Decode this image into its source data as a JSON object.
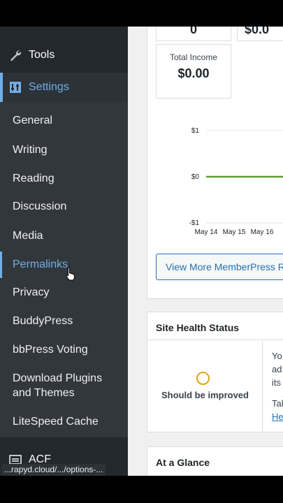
{
  "sidebar": {
    "tools_label": "Tools",
    "settings_label": "Settings",
    "submenu": [
      {
        "label": "General"
      },
      {
        "label": "Writing"
      },
      {
        "label": "Reading"
      },
      {
        "label": "Discussion"
      },
      {
        "label": "Media"
      },
      {
        "label": "Permalinks",
        "active": true
      },
      {
        "label": "Privacy"
      },
      {
        "label": "BuddyPress"
      },
      {
        "label": "bbPress Voting"
      },
      {
        "label": "Download Plugins and Themes"
      },
      {
        "label": "LiteSpeed Cache"
      }
    ],
    "acf_label": "ACF"
  },
  "status_url": "...rapyd.cloud/.../options-...",
  "stats": {
    "top_left_value": "0",
    "top_right_value": "$0.0",
    "total_income_label": "Total Income",
    "total_income_value": "$0.00"
  },
  "chart_data": {
    "type": "line",
    "categories": [
      "May 14",
      "May 15",
      "May 16"
    ],
    "series": [
      {
        "values": [
          0,
          0,
          0
        ]
      }
    ],
    "y_ticks": [
      "$1",
      "$0",
      "-$1"
    ],
    "ylim": [
      -1,
      1
    ],
    "color": "#5f9a2d"
  },
  "view_more_button": "View More MemberPress R",
  "site_health": {
    "title": "Site Health Status",
    "status": "Should be improved",
    "right_text_lines": [
      "Yo",
      "ad",
      "its"
    ],
    "right_text2": "Tal",
    "right_link": "He"
  },
  "at_a_glance": {
    "title": "At a Glance"
  }
}
